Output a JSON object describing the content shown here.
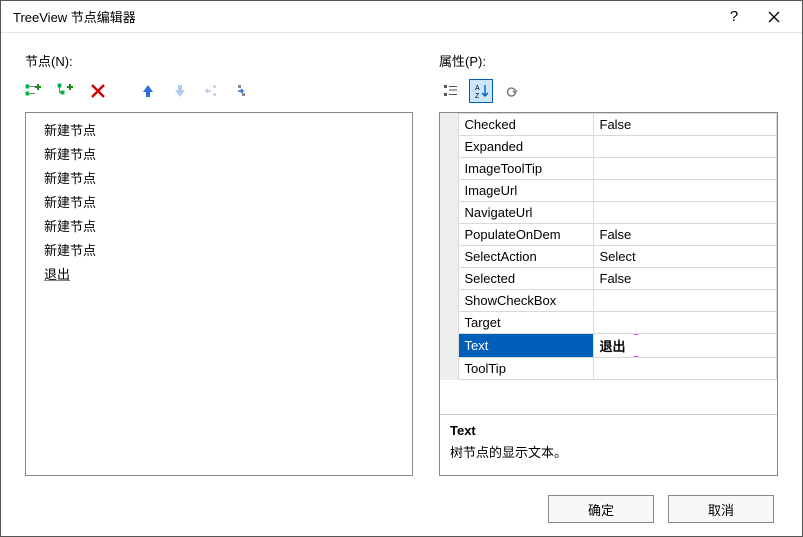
{
  "titlebar": {
    "title": "TreeView 节点编辑器"
  },
  "left": {
    "label": "节点(N):",
    "nodes": [
      "新建节点",
      "新建节点",
      "新建节点",
      "新建节点",
      "新建节点",
      "新建节点",
      "退出"
    ],
    "selected_index": 6
  },
  "right": {
    "label": "属性(P):",
    "properties": [
      {
        "name": "Checked",
        "value": "False"
      },
      {
        "name": "Expanded",
        "value": ""
      },
      {
        "name": "ImageToolTip",
        "value": ""
      },
      {
        "name": "ImageUrl",
        "value": ""
      },
      {
        "name": "NavigateUrl",
        "value": ""
      },
      {
        "name": "PopulateOnDem",
        "value": "False"
      },
      {
        "name": "SelectAction",
        "value": "Select"
      },
      {
        "name": "Selected",
        "value": "False"
      },
      {
        "name": "ShowCheckBox",
        "value": ""
      },
      {
        "name": "Target",
        "value": ""
      },
      {
        "name": "Text",
        "value": "退出"
      },
      {
        "name": "ToolTip",
        "value": ""
      }
    ],
    "selected_index": 10,
    "description": {
      "name": "Text",
      "text": "树节点的显示文本。"
    }
  },
  "footer": {
    "ok": "确定",
    "cancel": "取消"
  }
}
